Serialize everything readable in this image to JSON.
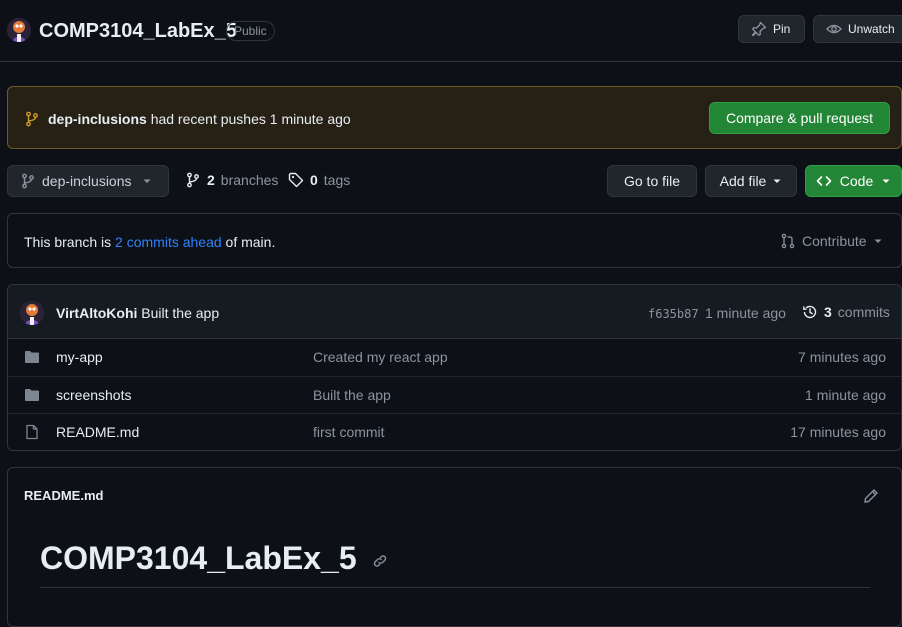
{
  "repo": {
    "name": "COMP3104_LabEx_5",
    "visibility": "Public",
    "pin_label": "Pin",
    "unwatch_label": "Unwatch"
  },
  "push_banner": {
    "branch": "dep-inclusions",
    "message": "had recent pushes 1 minute ago",
    "compare_label": "Compare & pull request"
  },
  "branch_bar": {
    "current_branch": "dep-inclusions",
    "branches_count": "2",
    "branches_label": "branches",
    "tags_count": "0",
    "tags_label": "tags",
    "go_to_file": "Go to file",
    "add_file": "Add file",
    "code": "Code"
  },
  "ahead": {
    "prefix": "This branch is",
    "link": "2 commits ahead",
    "suffix": "of main.",
    "contribute": "Contribute"
  },
  "latest_commit": {
    "author": "VirtAltoKohi",
    "message": "Built the app",
    "sha": "f635b87",
    "age": "1 minute ago",
    "commits_count": "3",
    "commits_label": "commits"
  },
  "files": [
    {
      "type": "folder",
      "name": "my-app",
      "message": "Created my react app",
      "age": "7 minutes ago"
    },
    {
      "type": "folder",
      "name": "screenshots",
      "message": "Built the app",
      "age": "1 minute ago"
    },
    {
      "type": "file",
      "name": "README.md",
      "message": "first commit",
      "age": "17 minutes ago"
    }
  ],
  "readme": {
    "filename": "README.md",
    "heading": "COMP3104_LabEx_5"
  },
  "colors": {
    "background": "#0d1117",
    "accent_blue": "#2f81f7",
    "button_green": "#238636",
    "banner_bg": "#272115",
    "banner_border": "#6e5a26"
  }
}
